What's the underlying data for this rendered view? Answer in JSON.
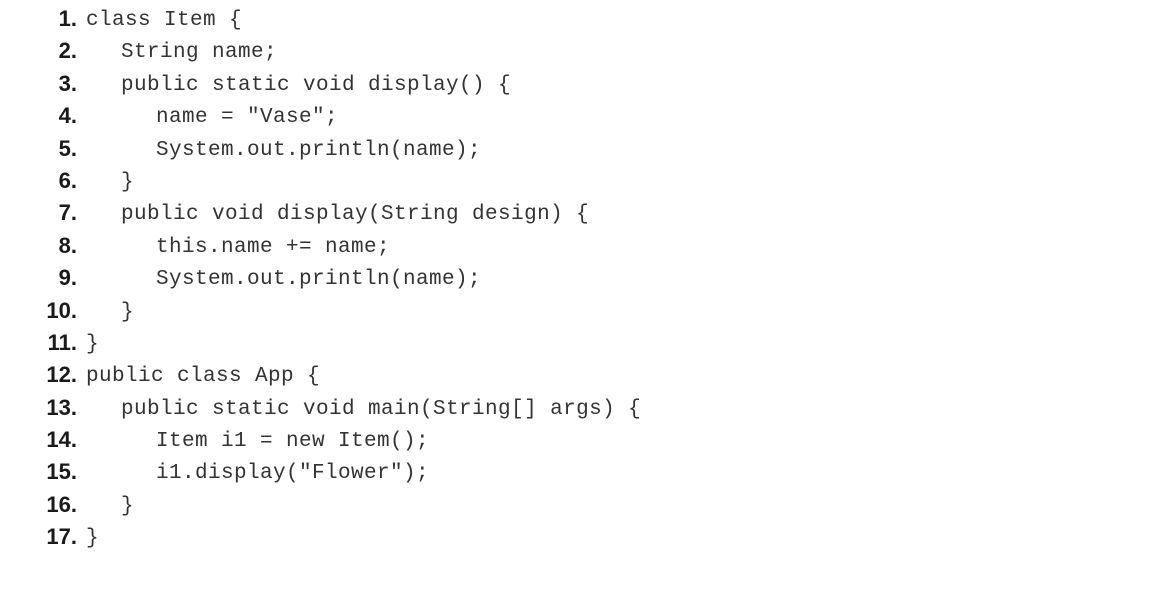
{
  "code": {
    "lines": [
      {
        "num": "1.",
        "text": "class Item {"
      },
      {
        "num": "2.",
        "text": "String name;"
      },
      {
        "num": "3.",
        "text": "public static void display() {"
      },
      {
        "num": "4.",
        "text": "name = \"Vase\";"
      },
      {
        "num": "5.",
        "text": "System.out.println(name);"
      },
      {
        "num": "6.",
        "text": "}"
      },
      {
        "num": "7.",
        "text": "public void display(String design) {"
      },
      {
        "num": "8.",
        "text": "this.name += name;"
      },
      {
        "num": "9.",
        "text": "System.out.println(name);"
      },
      {
        "num": "10.",
        "text": "}"
      },
      {
        "num": "11.",
        "text": "}"
      },
      {
        "num": "12.",
        "text": "public class App {"
      },
      {
        "num": "13.",
        "text": "public static void main(String[] args) {"
      },
      {
        "num": "14.",
        "text": "Item i1 = new Item();"
      },
      {
        "num": "15.",
        "text": "i1.display(\"Flower\");"
      },
      {
        "num": "16.",
        "text": "}"
      },
      {
        "num": "17.",
        "text": "}"
      }
    ]
  }
}
